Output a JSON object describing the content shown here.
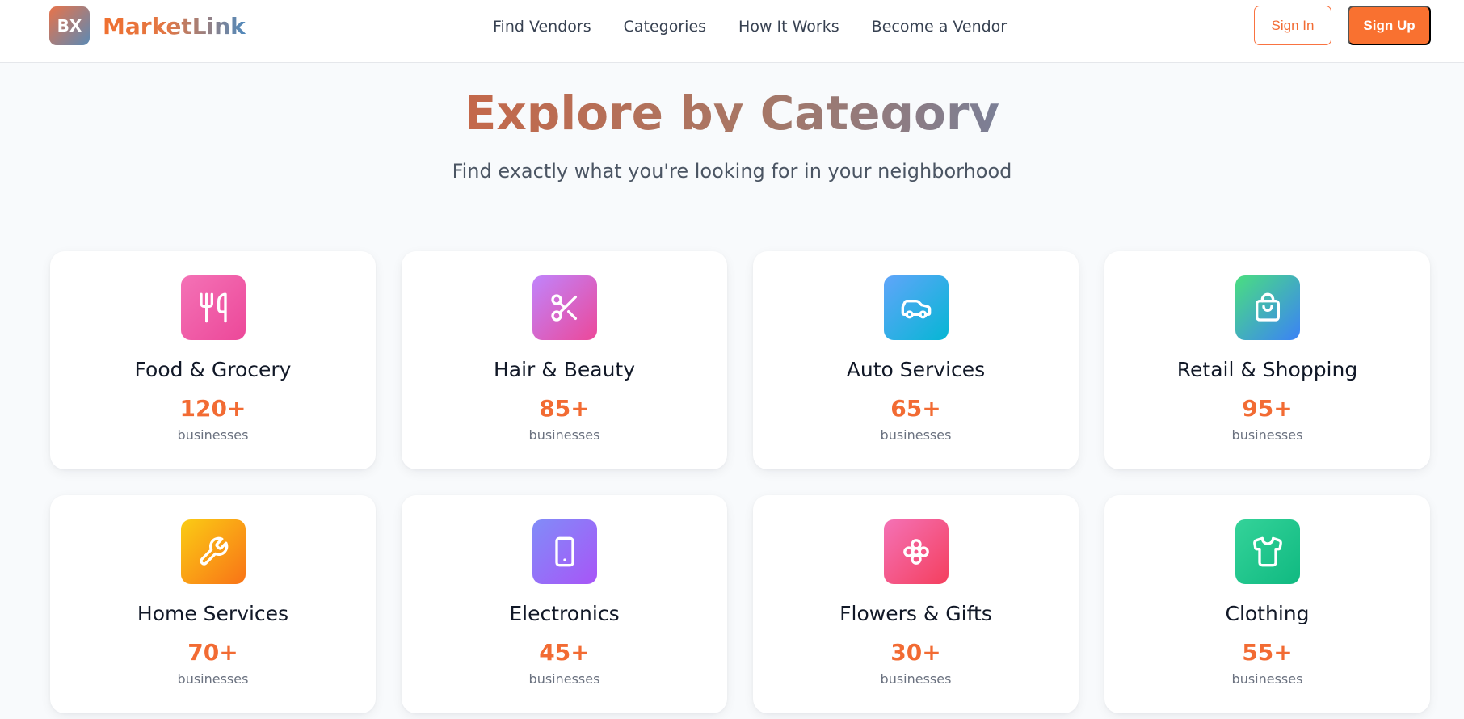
{
  "brand": {
    "logo_text": "BX",
    "name": "MarketLink"
  },
  "nav": {
    "links": [
      "Find Vendors",
      "Categories",
      "How It Works",
      "Become a Vendor"
    ]
  },
  "auth": {
    "sign_in": "Sign In",
    "sign_up": "Sign Up"
  },
  "hero": {
    "title": "Explore by Category",
    "subtitle": "Find exactly what you're looking for in your neighborhood"
  },
  "categories": [
    {
      "name": "Food & Grocery",
      "count": "120+",
      "unit": "businesses",
      "icon": "utensils-icon",
      "gradient": [
        "#f472b6",
        "#ec4899"
      ]
    },
    {
      "name": "Hair & Beauty",
      "count": "85+",
      "unit": "businesses",
      "icon": "scissors-icon",
      "gradient": [
        "#c084fc",
        "#ec4899"
      ]
    },
    {
      "name": "Auto Services",
      "count": "65+",
      "unit": "businesses",
      "icon": "car-icon",
      "gradient": [
        "#60a5fa",
        "#06b6d4"
      ]
    },
    {
      "name": "Retail & Shopping",
      "count": "95+",
      "unit": "businesses",
      "icon": "shopping-bag-icon",
      "gradient": [
        "#4ade80",
        "#3b82f6"
      ]
    },
    {
      "name": "Home Services",
      "count": "70+",
      "unit": "businesses",
      "icon": "wrench-icon",
      "gradient": [
        "#facc15",
        "#f97316"
      ]
    },
    {
      "name": "Electronics",
      "count": "45+",
      "unit": "businesses",
      "icon": "tablet-icon",
      "gradient": [
        "#818cf8",
        "#a855f7"
      ]
    },
    {
      "name": "Flowers & Gifts",
      "count": "30+",
      "unit": "businesses",
      "icon": "flower-icon",
      "gradient": [
        "#f472b6",
        "#f43f5e"
      ]
    },
    {
      "name": "Clothing",
      "count": "55+",
      "unit": "businesses",
      "icon": "shirt-icon",
      "gradient": [
        "#34d399",
        "#10b981"
      ]
    }
  ]
}
